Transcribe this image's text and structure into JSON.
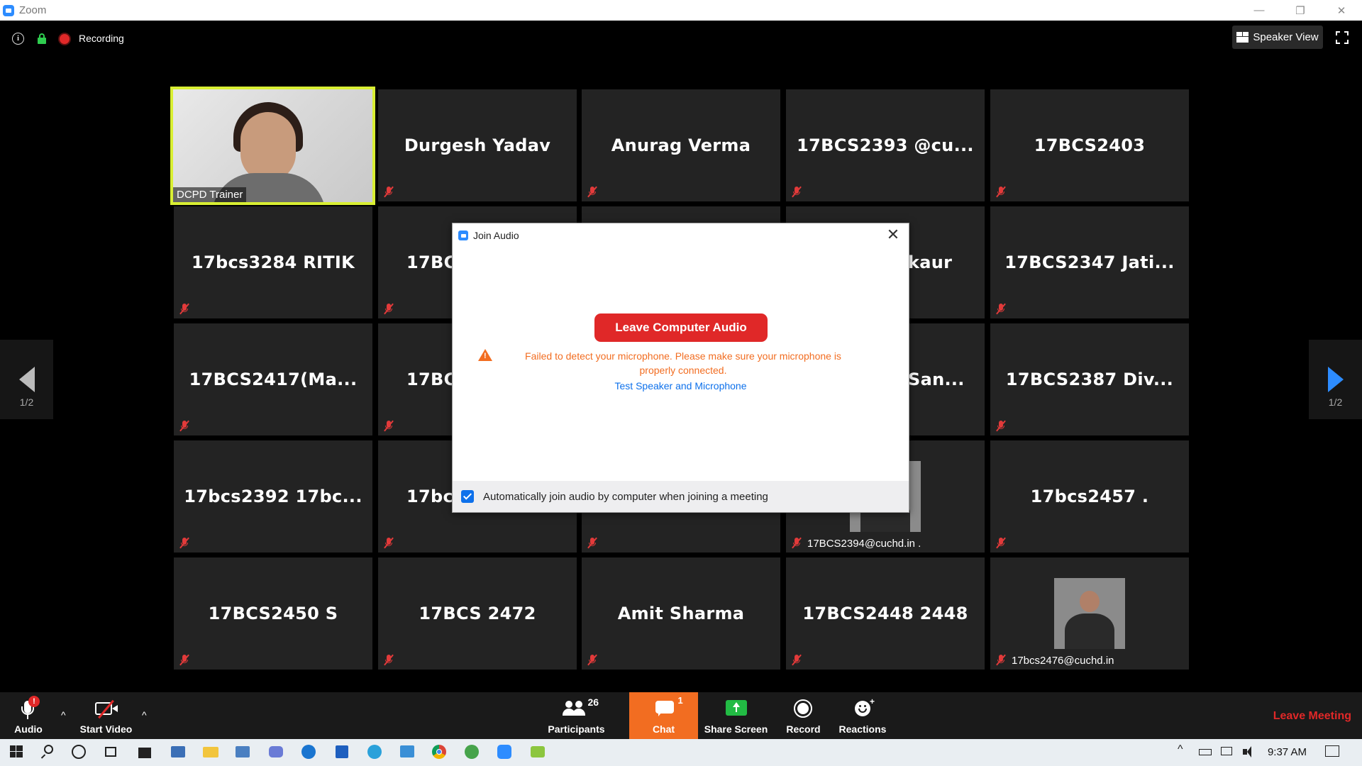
{
  "window": {
    "title": "Zoom",
    "controls": [
      "—",
      "❐",
      "✕"
    ]
  },
  "topbar": {
    "info_glyph": "i",
    "recording_label": "Recording",
    "speaker_view_label": "Speaker View"
  },
  "participants_grid": [
    {
      "name": "",
      "label": "DCPD Trainer",
      "type": "video",
      "active": true
    },
    {
      "name": "Durgesh Yadav",
      "type": "name"
    },
    {
      "name": "Anurag Verma",
      "type": "name"
    },
    {
      "name": "17BCS2393  @cu...",
      "type": "name"
    },
    {
      "name": "17BCS2403",
      "type": "name"
    },
    {
      "name": "17bcs3284 RITIK",
      "type": "name"
    },
    {
      "name": "17BCS",
      "type": "name-partial"
    },
    {
      "name": "",
      "type": "hidden"
    },
    {
      "name": "kaur",
      "type": "name-partial-right"
    },
    {
      "name": "17BCS2347  Jati...",
      "type": "name"
    },
    {
      "name": "17BCS2417(Ma...",
      "type": "name"
    },
    {
      "name": "17BCS",
      "type": "name-partial"
    },
    {
      "name": "",
      "type": "hidden"
    },
    {
      "name": "San...",
      "type": "name-partial-right"
    },
    {
      "name": "17BCS2387  Div...",
      "type": "name"
    },
    {
      "name": "17bcs2392  17bc...",
      "type": "name"
    },
    {
      "name": "17bcs",
      "type": "name-partial"
    },
    {
      "name": "",
      "type": "hidden"
    },
    {
      "name": "",
      "label": "17BCS2394@cuchd.in .",
      "type": "photo"
    },
    {
      "name": "17bcs2457 .",
      "type": "name"
    },
    {
      "name": "17BCS2450 S",
      "type": "name"
    },
    {
      "name": "17BCS 2472",
      "type": "name"
    },
    {
      "name": "Amit Sharma",
      "type": "name"
    },
    {
      "name": "17BCS2448 2448",
      "type": "name"
    },
    {
      "name": "",
      "label": "17bcs2476@cuchd.in",
      "type": "photo"
    }
  ],
  "pagination": {
    "left": "1/2",
    "right": "1/2"
  },
  "dialog": {
    "title": "Join Audio",
    "close_glyph": "✕",
    "leave_button": "Leave Computer Audio",
    "warning_glyph": "!",
    "warning_text": "Failed to detect your microphone. Please make sure your microphone is properly connected.",
    "test_link": "Test Speaker and Microphone",
    "auto_join_label": "Automatically join audio by computer when joining a meeting",
    "auto_join_checked": true
  },
  "toolbar": {
    "audio_label": "Audio",
    "audio_badge": "!",
    "start_video_label": "Start Video",
    "participants_label": "Participants",
    "participants_count": "26",
    "chat_label": "Chat",
    "chat_badge": "1",
    "share_screen_label": "Share Screen",
    "record_label": "Record",
    "reactions_label": "Reactions",
    "leave_meeting_label": "Leave Meeting",
    "caret_glyph": "^"
  },
  "taskbar": {
    "time": "9:37 AM"
  },
  "colors": {
    "accent": "#2d8cff",
    "danger": "#e02828",
    "warning": "#f26d21",
    "active_border": "#d9ef33",
    "chat": "#f26d21"
  }
}
